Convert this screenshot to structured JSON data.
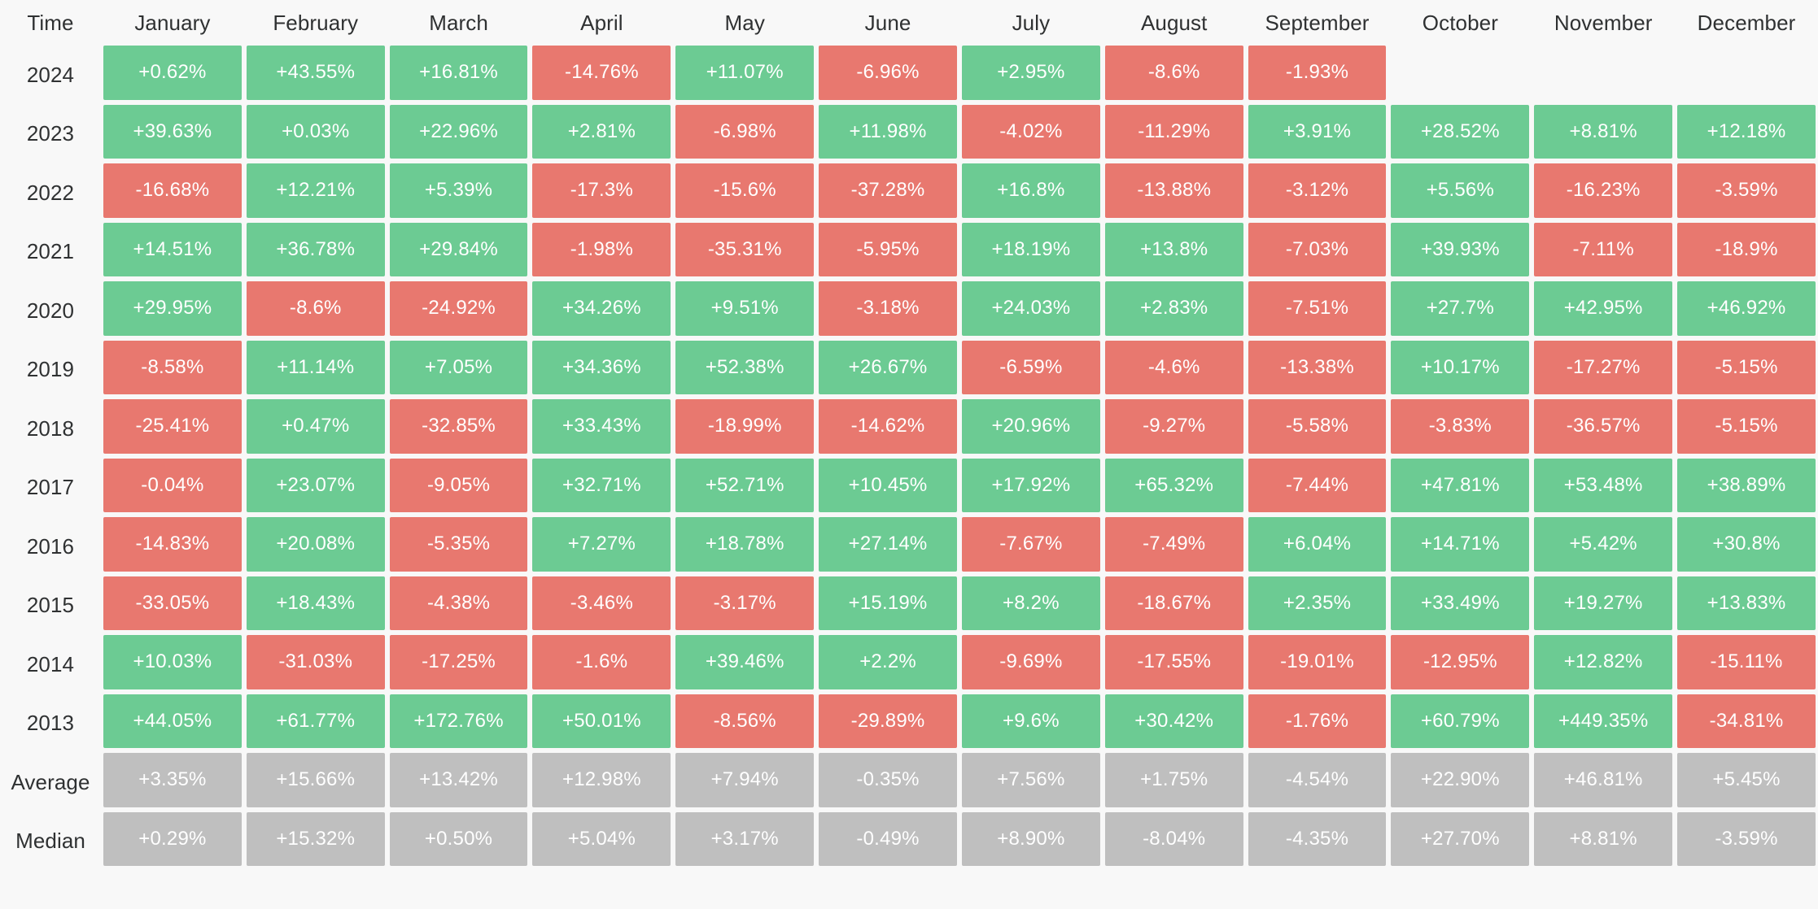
{
  "table": {
    "corner_label": "Time",
    "columns": [
      "January",
      "February",
      "March",
      "April",
      "May",
      "June",
      "July",
      "August",
      "September",
      "October",
      "November",
      "December"
    ],
    "rows": [
      {
        "label": "2024",
        "values": [
          "+0.62%",
          "+43.55%",
          "+16.81%",
          "-14.76%",
          "+11.07%",
          "-6.96%",
          "+2.95%",
          "-8.6%",
          "-1.93%",
          "",
          "",
          ""
        ]
      },
      {
        "label": "2023",
        "values": [
          "+39.63%",
          "+0.03%",
          "+22.96%",
          "+2.81%",
          "-6.98%",
          "+11.98%",
          "-4.02%",
          "-11.29%",
          "+3.91%",
          "+28.52%",
          "+8.81%",
          "+12.18%"
        ]
      },
      {
        "label": "2022",
        "values": [
          "-16.68%",
          "+12.21%",
          "+5.39%",
          "-17.3%",
          "-15.6%",
          "-37.28%",
          "+16.8%",
          "-13.88%",
          "-3.12%",
          "+5.56%",
          "-16.23%",
          "-3.59%"
        ]
      },
      {
        "label": "2021",
        "values": [
          "+14.51%",
          "+36.78%",
          "+29.84%",
          "-1.98%",
          "-35.31%",
          "-5.95%",
          "+18.19%",
          "+13.8%",
          "-7.03%",
          "+39.93%",
          "-7.11%",
          "-18.9%"
        ]
      },
      {
        "label": "2020",
        "values": [
          "+29.95%",
          "-8.6%",
          "-24.92%",
          "+34.26%",
          "+9.51%",
          "-3.18%",
          "+24.03%",
          "+2.83%",
          "-7.51%",
          "+27.7%",
          "+42.95%",
          "+46.92%"
        ]
      },
      {
        "label": "2019",
        "values": [
          "-8.58%",
          "+11.14%",
          "+7.05%",
          "+34.36%",
          "+52.38%",
          "+26.67%",
          "-6.59%",
          "-4.6%",
          "-13.38%",
          "+10.17%",
          "-17.27%",
          "-5.15%"
        ]
      },
      {
        "label": "2018",
        "values": [
          "-25.41%",
          "+0.47%",
          "-32.85%",
          "+33.43%",
          "-18.99%",
          "-14.62%",
          "+20.96%",
          "-9.27%",
          "-5.58%",
          "-3.83%",
          "-36.57%",
          "-5.15%"
        ]
      },
      {
        "label": "2017",
        "values": [
          "-0.04%",
          "+23.07%",
          "-9.05%",
          "+32.71%",
          "+52.71%",
          "+10.45%",
          "+17.92%",
          "+65.32%",
          "-7.44%",
          "+47.81%",
          "+53.48%",
          "+38.89%"
        ]
      },
      {
        "label": "2016",
        "values": [
          "-14.83%",
          "+20.08%",
          "-5.35%",
          "+7.27%",
          "+18.78%",
          "+27.14%",
          "-7.67%",
          "-7.49%",
          "+6.04%",
          "+14.71%",
          "+5.42%",
          "+30.8%"
        ]
      },
      {
        "label": "2015",
        "values": [
          "-33.05%",
          "+18.43%",
          "-4.38%",
          "-3.46%",
          "-3.17%",
          "+15.19%",
          "+8.2%",
          "-18.67%",
          "+2.35%",
          "+33.49%",
          "+19.27%",
          "+13.83%"
        ]
      },
      {
        "label": "2014",
        "values": [
          "+10.03%",
          "-31.03%",
          "-17.25%",
          "-1.6%",
          "+39.46%",
          "+2.2%",
          "-9.69%",
          "-17.55%",
          "-19.01%",
          "-12.95%",
          "+12.82%",
          "-15.11%"
        ]
      },
      {
        "label": "2013",
        "values": [
          "+44.05%",
          "+61.77%",
          "+172.76%",
          "+50.01%",
          "-8.56%",
          "-29.89%",
          "+9.6%",
          "+30.42%",
          "-1.76%",
          "+60.79%",
          "+449.35%",
          "-34.81%"
        ]
      }
    ],
    "summary_rows": [
      {
        "label": "Average",
        "values": [
          "+3.35%",
          "+15.66%",
          "+13.42%",
          "+12.98%",
          "+7.94%",
          "-0.35%",
          "+7.56%",
          "+1.75%",
          "-4.54%",
          "+22.90%",
          "+46.81%",
          "+5.45%"
        ]
      },
      {
        "label": "Median",
        "values": [
          "+0.29%",
          "+15.32%",
          "+0.50%",
          "+5.04%",
          "+3.17%",
          "-0.49%",
          "+8.90%",
          "-8.04%",
          "-4.35%",
          "+27.70%",
          "+8.81%",
          "-3.59%"
        ]
      }
    ],
    "colors": {
      "positive": "#6ccb93",
      "negative": "#e8786f",
      "aggregate": "#bfbfbf",
      "background": "#f8f8f8",
      "text": "#2f3132",
      "cell_text": "#ffffff"
    }
  },
  "chart_data": {
    "type": "heatmap",
    "title": "",
    "xlabel": "",
    "ylabel": "Time",
    "x_categories": [
      "January",
      "February",
      "March",
      "April",
      "May",
      "June",
      "July",
      "August",
      "September",
      "October",
      "November",
      "December"
    ],
    "y_categories": [
      "2024",
      "2023",
      "2022",
      "2021",
      "2020",
      "2019",
      "2018",
      "2017",
      "2016",
      "2015",
      "2014",
      "2013",
      "Average",
      "Median"
    ],
    "unit": "percent",
    "color_rule": "green when value > 0, red when value < 0, grey for Average/Median summary rows",
    "values": [
      [
        0.62,
        43.55,
        16.81,
        -14.76,
        11.07,
        -6.96,
        2.95,
        -8.6,
        -1.93,
        null,
        null,
        null
      ],
      [
        39.63,
        0.03,
        22.96,
        2.81,
        -6.98,
        11.98,
        -4.02,
        -11.29,
        3.91,
        28.52,
        8.81,
        12.18
      ],
      [
        -16.68,
        12.21,
        5.39,
        -17.3,
        -15.6,
        -37.28,
        16.8,
        -13.88,
        -3.12,
        5.56,
        -16.23,
        -3.59
      ],
      [
        14.51,
        36.78,
        29.84,
        -1.98,
        -35.31,
        -5.95,
        18.19,
        13.8,
        -7.03,
        39.93,
        -7.11,
        -18.9
      ],
      [
        29.95,
        -8.6,
        -24.92,
        34.26,
        9.51,
        -3.18,
        24.03,
        2.83,
        -7.51,
        27.7,
        42.95,
        46.92
      ],
      [
        -8.58,
        11.14,
        7.05,
        34.36,
        52.38,
        26.67,
        -6.59,
        -4.6,
        -13.38,
        10.17,
        -17.27,
        -5.15
      ],
      [
        -25.41,
        0.47,
        -32.85,
        33.43,
        -18.99,
        -14.62,
        20.96,
        -9.27,
        -5.58,
        -3.83,
        -36.57,
        -5.15
      ],
      [
        -0.04,
        23.07,
        -9.05,
        32.71,
        52.71,
        10.45,
        17.92,
        65.32,
        -7.44,
        47.81,
        53.48,
        38.89
      ],
      [
        -14.83,
        20.08,
        -5.35,
        7.27,
        18.78,
        27.14,
        -7.67,
        -7.49,
        6.04,
        14.71,
        5.42,
        30.8
      ],
      [
        -33.05,
        18.43,
        -4.38,
        -3.46,
        -3.17,
        15.19,
        8.2,
        -18.67,
        2.35,
        33.49,
        19.27,
        13.83
      ],
      [
        10.03,
        -31.03,
        -17.25,
        -1.6,
        39.46,
        2.2,
        -9.69,
        -17.55,
        -19.01,
        -12.95,
        12.82,
        -15.11
      ],
      [
        44.05,
        61.77,
        172.76,
        50.01,
        -8.56,
        -29.89,
        9.6,
        30.42,
        -1.76,
        60.79,
        449.35,
        -34.81
      ],
      [
        3.35,
        15.66,
        13.42,
        12.98,
        7.94,
        -0.35,
        7.56,
        1.75,
        -4.54,
        22.9,
        46.81,
        5.45
      ],
      [
        0.29,
        15.32,
        0.5,
        5.04,
        3.17,
        -0.49,
        8.9,
        -8.04,
        -4.35,
        27.7,
        8.81,
        -3.59
      ]
    ]
  }
}
